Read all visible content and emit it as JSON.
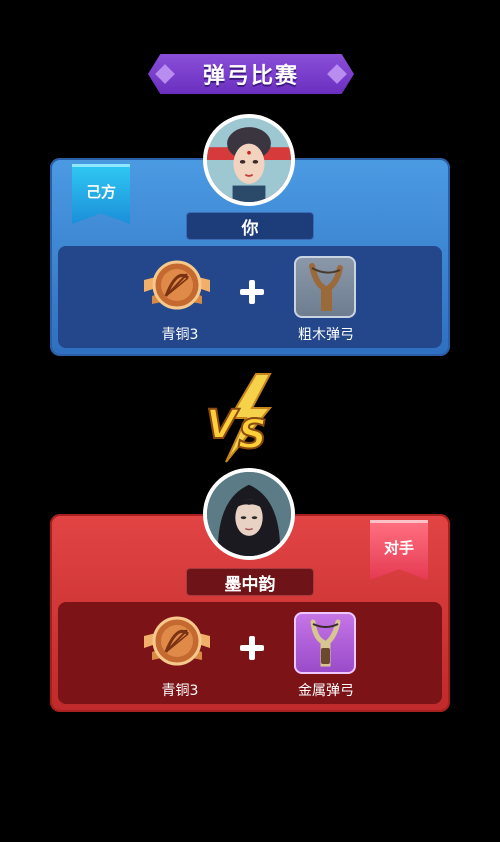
{
  "title": "弹弓比赛",
  "players": [
    {
      "side_tag": "己方",
      "name": "你",
      "rank": "青铜3",
      "item": "粗木弹弓"
    },
    {
      "side_tag": "对手",
      "name": "墨中韵",
      "rank": "青铜3",
      "item": "金属弹弓"
    }
  ],
  "colors": {
    "title_purple": "#7a3fcf",
    "own_blue": "#3b82d6",
    "enemy_red": "#d83a3a",
    "vs_gold": "#f6c13a"
  },
  "icons": {
    "rank": "bow-medal-icon",
    "item_own": "wood-slingshot-icon",
    "item_opponent": "metal-slingshot-icon",
    "vs": "vs-lightning-icon"
  }
}
